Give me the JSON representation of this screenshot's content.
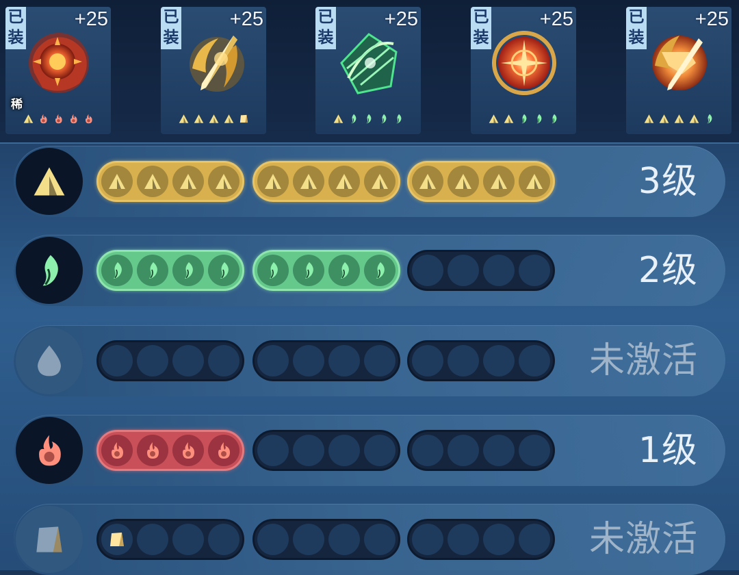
{
  "equipment": [
    {
      "equipped_label": "已装",
      "level_bonus": "+25",
      "rare_label": "稀",
      "element": "fire",
      "marks": [
        "earth",
        "fire",
        "fire",
        "fire",
        "fire"
      ]
    },
    {
      "equipped_label": "已装",
      "level_bonus": "+25",
      "rare_label": "",
      "element": "earth",
      "marks": [
        "earth",
        "earth",
        "earth",
        "earth",
        "stone"
      ]
    },
    {
      "equipped_label": "已装",
      "level_bonus": "+25",
      "rare_label": "",
      "element": "wood",
      "marks": [
        "earth",
        "wood",
        "wood",
        "wood",
        "wood"
      ]
    },
    {
      "equipped_label": "已装",
      "level_bonus": "+25",
      "rare_label": "",
      "element": "fire",
      "marks": [
        "earth",
        "earth",
        "wood",
        "wood",
        "wood"
      ]
    },
    {
      "equipped_label": "已装",
      "level_bonus": "+25",
      "rare_label": "",
      "element": "earth",
      "marks": [
        "earth",
        "earth",
        "earth",
        "earth",
        "wood"
      ]
    }
  ],
  "attributes": [
    {
      "name": "earth-attribute",
      "icon": "earth-icon",
      "level_text": "3级",
      "active": true,
      "filled_slots": 12,
      "fill_style": "gold"
    },
    {
      "name": "wood-attribute",
      "icon": "leaf-icon",
      "level_text": "2级",
      "active": true,
      "filled_slots": 8,
      "fill_style": "green"
    },
    {
      "name": "water-attribute",
      "icon": "water-drop-icon",
      "level_text": "未激活",
      "active": false,
      "filled_slots": 0,
      "fill_style": "none"
    },
    {
      "name": "fire-attribute",
      "icon": "flame-icon",
      "level_text": "1级",
      "active": true,
      "filled_slots": 4,
      "fill_style": "red"
    },
    {
      "name": "stone-attribute",
      "icon": "stone-icon",
      "level_text": "未激活",
      "active": false,
      "filled_slots": 1,
      "fill_style": "partial-stone"
    }
  ],
  "colors": {
    "earth": "#f3df8a",
    "wood": "#8ef0ad",
    "fire": "#ff8f7d",
    "water": "#a4b6c8",
    "stone": "#ffe6a0"
  }
}
